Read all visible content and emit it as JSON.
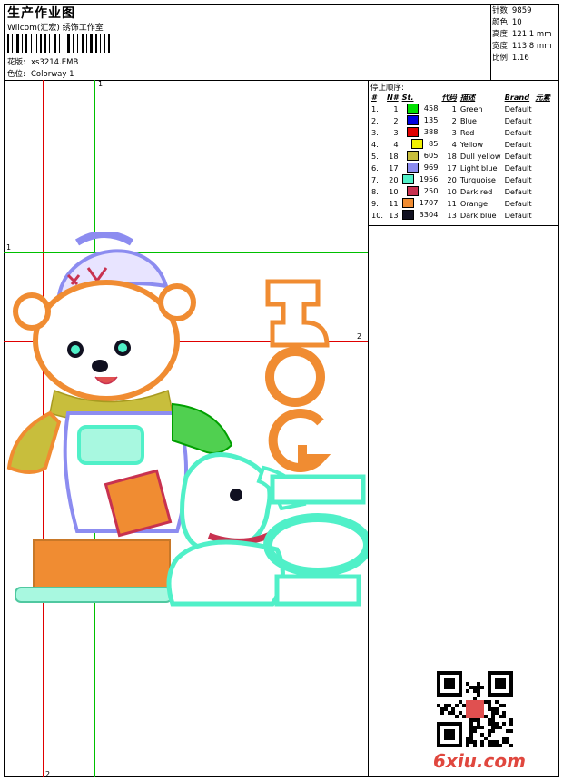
{
  "header": {
    "title": "生产作业图",
    "company": "Wilcom(汇宏) 绣饰工作室",
    "design_label": "花版:",
    "design_value": "xs3214.EMB",
    "colorway_label": "色位:",
    "colorway_value": "Colorway 1"
  },
  "stats": [
    {
      "label": "针数:",
      "value": "9859"
    },
    {
      "label": "颜色:",
      "value": "10"
    },
    {
      "label": "高度:",
      "value": "121.1 mm"
    },
    {
      "label": "宽度:",
      "value": "113.8 mm"
    },
    {
      "label": "比例:",
      "value": "1.16"
    }
  ],
  "stop_sequence": {
    "title": "停止顺序:",
    "columns": [
      "#",
      "N#",
      "St.",
      "代码",
      "描述",
      "Brand",
      "元素"
    ],
    "rows": [
      {
        "idx": "1.",
        "n": "1",
        "color": "#00e000",
        "st": "458",
        "code": "1",
        "desc": "Green",
        "brand": "Default"
      },
      {
        "idx": "2.",
        "n": "2",
        "color": "#0000e0",
        "st": "135",
        "code": "2",
        "desc": "Blue",
        "brand": "Default"
      },
      {
        "idx": "3.",
        "n": "3",
        "color": "#e00000",
        "st": "388",
        "code": "3",
        "desc": "Red",
        "brand": "Default"
      },
      {
        "idx": "4.",
        "n": "4",
        "color": "#f0f000",
        "st": "85",
        "code": "4",
        "desc": "Yellow",
        "brand": "Default"
      },
      {
        "idx": "5.",
        "n": "18",
        "color": "#c8be3c",
        "st": "605",
        "code": "18",
        "desc": "Dull yellow",
        "brand": "Default"
      },
      {
        "idx": "6.",
        "n": "17",
        "color": "#8c8cf0",
        "st": "969",
        "code": "17",
        "desc": "Light blue",
        "brand": "Default"
      },
      {
        "idx": "7.",
        "n": "20",
        "color": "#50f0c8",
        "st": "1956",
        "code": "20",
        "desc": "Turquoise",
        "brand": "Default"
      },
      {
        "idx": "8.",
        "n": "10",
        "color": "#c83250",
        "st": "250",
        "code": "10",
        "desc": "Dark red",
        "brand": "Default"
      },
      {
        "idx": "9.",
        "n": "11",
        "color": "#f08c32",
        "st": "1707",
        "code": "11",
        "desc": "Orange",
        "brand": "Default"
      },
      {
        "idx": "10.",
        "n": "13",
        "color": "#101020",
        "st": "3304",
        "code": "13",
        "desc": "Dark blue",
        "brand": "Default"
      }
    ]
  },
  "guides": {
    "v1": "1",
    "v2": "2",
    "h1": "1",
    "h2": "2"
  },
  "artwork": {
    "word": "DOG"
  },
  "watermark": "6xiu.com"
}
